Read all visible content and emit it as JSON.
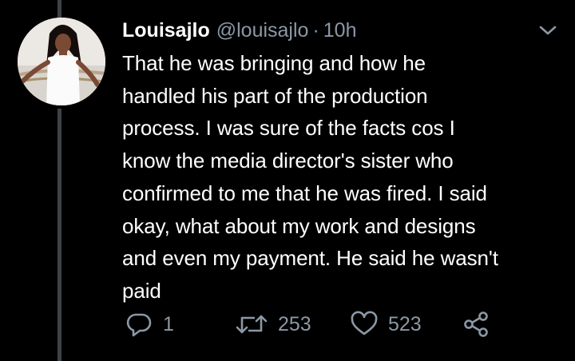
{
  "tweet": {
    "display_name": "Louisajlo",
    "handle": "@louisajlo",
    "separator": "·",
    "timestamp": "10h",
    "text_lines": [
      "That he was bringing and how he",
      "handled his part of the production",
      "process. I was sure of the facts cos I",
      "know the media director's sister who",
      "confirmed to me that he was fired. I said",
      "okay, what about my work and designs",
      "and even my payment. He said he wasn't",
      "paid"
    ]
  },
  "actions": {
    "reply_icon": "reply-icon",
    "reply_count": "1",
    "retweet_icon": "retweet-icon",
    "retweet_count": "253",
    "like_icon": "heart-icon",
    "like_count": "523",
    "share_icon": "share-icon"
  },
  "colors": {
    "background": "#000000",
    "primary_text": "#ffffff",
    "secondary_text": "#8b98a5",
    "thread_line": "#3d4248"
  }
}
